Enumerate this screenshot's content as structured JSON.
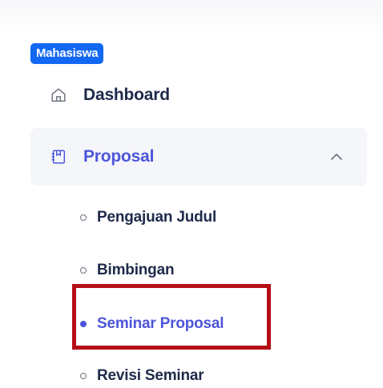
{
  "sidebar": {
    "role_badge": "Mahasiswa",
    "items": [
      {
        "label": "Dashboard",
        "icon": "home-icon"
      },
      {
        "label": "Proposal",
        "icon": "proposal-icon",
        "expanded": true,
        "toggle_icon": "chevron-up-icon"
      }
    ],
    "submenu": [
      {
        "label": "Pengajuan Judul",
        "active": false
      },
      {
        "label": "Bimbingan",
        "active": false
      },
      {
        "label": "Seminar Proposal",
        "active": true
      },
      {
        "label": "Revisi Seminar",
        "active": false
      }
    ]
  },
  "colors": {
    "badge": "#1268f3",
    "active_text": "#4d55d9",
    "default_text": "#1e2a4a",
    "highlight_border": "#b50f16",
    "active_bg": "#f5f6fa"
  }
}
